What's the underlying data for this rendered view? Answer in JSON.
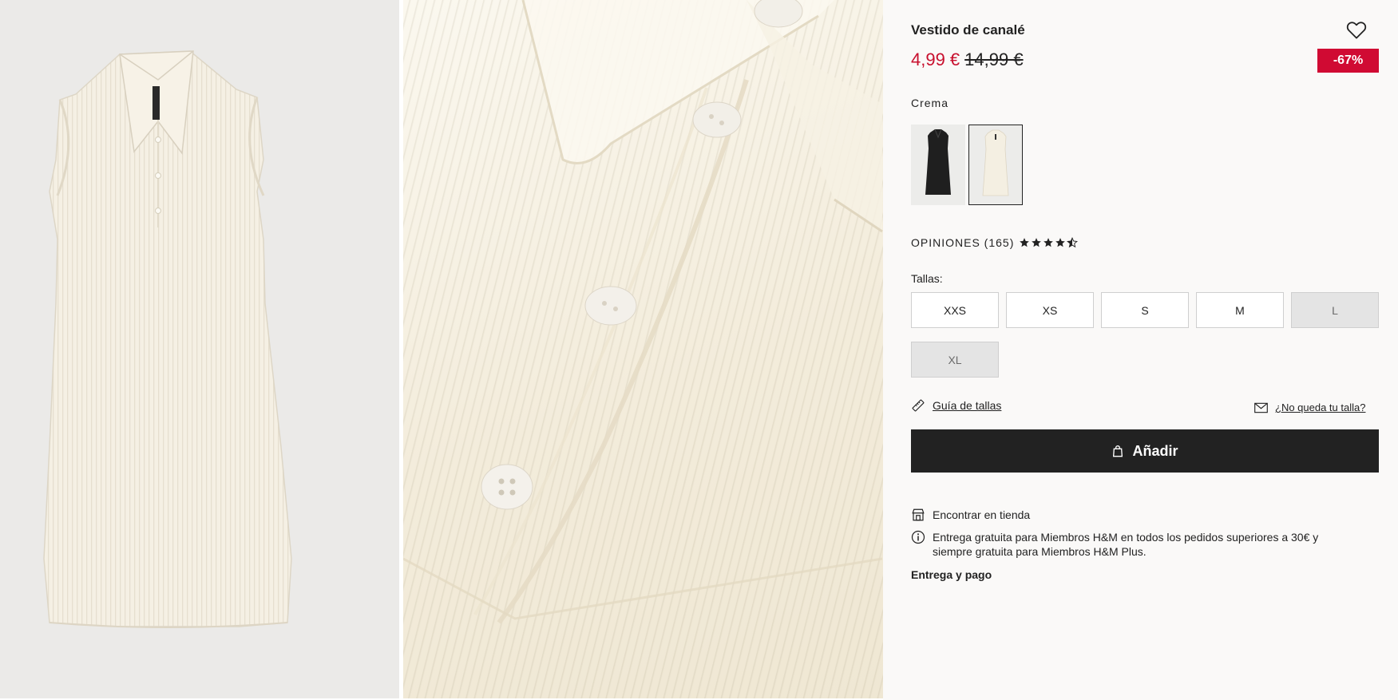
{
  "product": {
    "title": "Vestido de canalé",
    "price_current": "4,99 €",
    "price_original": "14,99 €",
    "discount_badge": "-67%",
    "colors": {
      "selected_label": "Crema",
      "swatches": [
        {
          "name": "black",
          "hex": "#222222"
        },
        {
          "name": "cream",
          "hex": "#f4efe2"
        }
      ]
    },
    "reviews": {
      "label": "OPINIONES (165)",
      "rating": 4.5,
      "max": 5
    },
    "sizes": {
      "label": "Tallas:",
      "options": [
        {
          "label": "XXS",
          "available": true
        },
        {
          "label": "XS",
          "available": true
        },
        {
          "label": "S",
          "available": true
        },
        {
          "label": "M",
          "available": true
        },
        {
          "label": "L",
          "available": false
        },
        {
          "label": "XL",
          "available": false
        }
      ]
    },
    "size_guide": "Guía de tallas",
    "fit_issue": "¿No queda tu talla?",
    "add_button": "Añadir",
    "find_in_store": "Encontrar en tienda",
    "delivery_info": "Entrega gratuita para Miembros H&M en todos los pedidos superiores a 30€ y siempre gratuita para Miembros H&M Plus.",
    "delivery_payment": "Entrega y pago"
  },
  "colors": {
    "sale_red": "#c8102e",
    "badge_red": "#d00a33",
    "button_dark": "#222222",
    "panel_bg": "#faf9f8"
  },
  "icons": {
    "favorite": "heart-icon",
    "star": "star-icon",
    "ruler": "ruler-icon",
    "mail": "envelope-icon",
    "bag": "shopping-bag-icon",
    "store": "store-icon",
    "info": "info-icon"
  }
}
